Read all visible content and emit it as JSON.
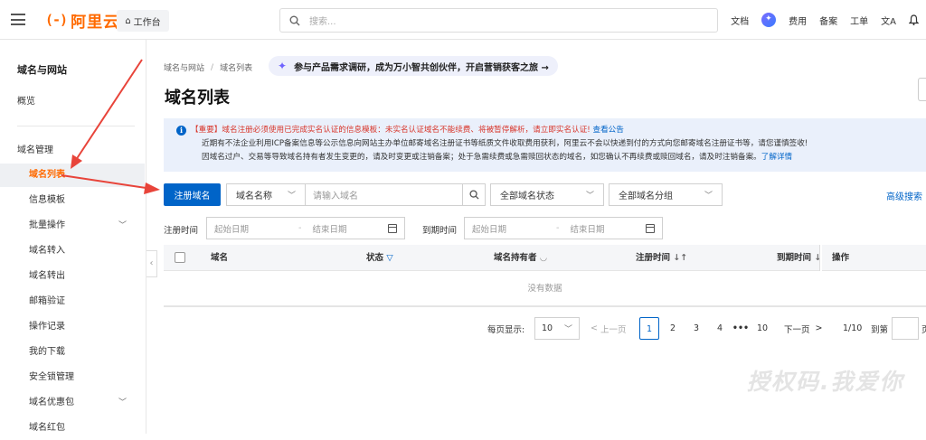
{
  "header": {
    "logo_mark": "(-)",
    "logo_text": "阿里云",
    "workbench": "工作台",
    "search_placeholder": "搜索...",
    "nav": [
      "文档",
      "费用",
      "备案",
      "工单"
    ]
  },
  "sidebar": {
    "title": "域名与网站",
    "overview": "概览",
    "section": "域名管理",
    "items": [
      {
        "label": "域名列表"
      },
      {
        "label": "信息模板"
      },
      {
        "label": "批量操作"
      },
      {
        "label": "域名转入"
      },
      {
        "label": "域名转出"
      },
      {
        "label": "邮箱验证"
      },
      {
        "label": "操作记录"
      },
      {
        "label": "我的下载"
      },
      {
        "label": "安全锁管理"
      },
      {
        "label": "域名优惠包"
      },
      {
        "label": "域名红包"
      }
    ]
  },
  "breadcrumb": [
    "域名与网站",
    "域名列表"
  ],
  "promo": "参与产品需求调研，成为万小智共创伙伴，开启营销获客之旅 →",
  "page_title": "域名列表",
  "notice": {
    "line1_red": "【重要】域名注册必须使用已完成实名认证的信息模板：未实名认证域名不能续费、将被暂停解析，请立即实名认证!",
    "line1_link": "查看公告",
    "line2": "近期有不法企业利用ICP备案信息等公示信息向网站主办单位邮寄域名注册证书等纸质文件收取费用获利，阿里云不会以快递到付的方式向您邮寄域名注册证书等，请您谨慎签收!",
    "line3": "因域名过户、交易等导致域名持有者发生变更的，请及时变更或注销备案；处于急需续费或急需赎回状态的域名，如您确认不再续费或赎回域名，请及时注销备案。",
    "line3_link": "了解详情"
  },
  "toolbar": {
    "register_button": "注册域名",
    "field_select": "域名名称",
    "keyword_placeholder": "请输入域名",
    "status_select": "全部域名状态",
    "group_select": "全部域名分组",
    "advanced": "高级搜索"
  },
  "dates": {
    "reg_label": "注册时间",
    "exp_label": "到期时间",
    "start": "起始日期",
    "end": "结束日期"
  },
  "table": {
    "columns": [
      "域名",
      "状态",
      "域名持有者",
      "注册时间",
      "到期时间",
      "操作"
    ],
    "empty": "没有数据"
  },
  "pagination": {
    "per_page_label": "每页显示:",
    "per_page": "10",
    "prev": "上一页",
    "pages": [
      "1",
      "2",
      "3",
      "4",
      "•••",
      "10"
    ],
    "next": "下一页",
    "page_info": "1/10",
    "goto_label": "到第",
    "goto_suffix": "页"
  },
  "watermark": "授权码.我爱你",
  "colors": {
    "brand": "#ff6a00",
    "primary": "#0064c8",
    "annotation": "#e8443a"
  }
}
